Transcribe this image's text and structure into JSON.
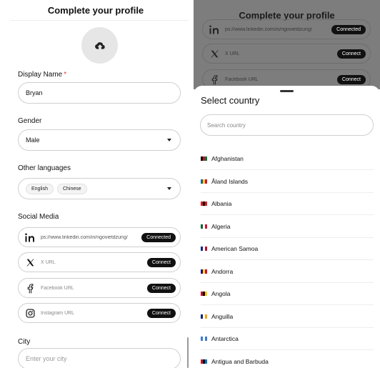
{
  "left": {
    "title": "Complete your profile",
    "display_name_label": "Display Name",
    "required_mark": "*",
    "display_name_value": "Bryan",
    "gender_label": "Gender",
    "gender_value": "Male",
    "languages_label": "Other languages",
    "languages": [
      "English",
      "Chinese"
    ],
    "social_label": "Social Media",
    "social": [
      {
        "icon": "linkedin-icon",
        "text": "ps://www.linkedin.com/in/ngovietdzung/",
        "button": "Connected"
      },
      {
        "icon": "x-icon",
        "text": "X URL",
        "button": "Connect"
      },
      {
        "icon": "facebook-icon",
        "text": "Facebook URL",
        "button": "Connect"
      },
      {
        "icon": "instagram-icon",
        "text": "Instagram URL",
        "button": "Connect"
      }
    ],
    "city_label": "City",
    "city_placeholder": "Enter your city"
  },
  "right": {
    "title": "Complete your profile",
    "dim_social": [
      {
        "icon": "linkedin-icon",
        "text": "ps://www.linkedin.com/in/ngovietdzung/",
        "button": "Connected"
      },
      {
        "icon": "x-icon",
        "text": "X URL",
        "button": "Connect"
      },
      {
        "icon": "facebook-icon",
        "text": "Facebook URL",
        "button": "Connect"
      }
    ],
    "sheet_title": "Select country",
    "search_placeholder": "Search country",
    "countries": [
      {
        "name": "Afghanistan",
        "flag": [
          "#000000",
          "#c8102e",
          "#007a36"
        ]
      },
      {
        "name": "Åland Islands",
        "flag": [
          "#0064ad",
          "#ffd300",
          "#d21034"
        ]
      },
      {
        "name": "Albania",
        "flag": [
          "#e41e20",
          "#000000",
          "#e41e20"
        ]
      },
      {
        "name": "Algeria",
        "flag": [
          "#006233",
          "#ffffff",
          "#d21034"
        ]
      },
      {
        "name": "American Samoa",
        "flag": [
          "#002b7f",
          "#ffffff",
          "#bf0a30"
        ]
      },
      {
        "name": "Andorra",
        "flag": [
          "#10069f",
          "#fedf00",
          "#d50032"
        ]
      },
      {
        "name": "Angola",
        "flag": [
          "#cc092f",
          "#000000",
          "#ffcb00"
        ]
      },
      {
        "name": "Anguilla",
        "flag": [
          "#00247d",
          "#ffffff",
          "#f7a800"
        ]
      },
      {
        "name": "Antarctica",
        "flag": [
          "#3a7dce",
          "#ffffff",
          "#3a7dce"
        ]
      },
      {
        "name": "Antigua and Barbuda",
        "flag": [
          "#ce1126",
          "#000000",
          "#0072c6"
        ]
      }
    ]
  }
}
